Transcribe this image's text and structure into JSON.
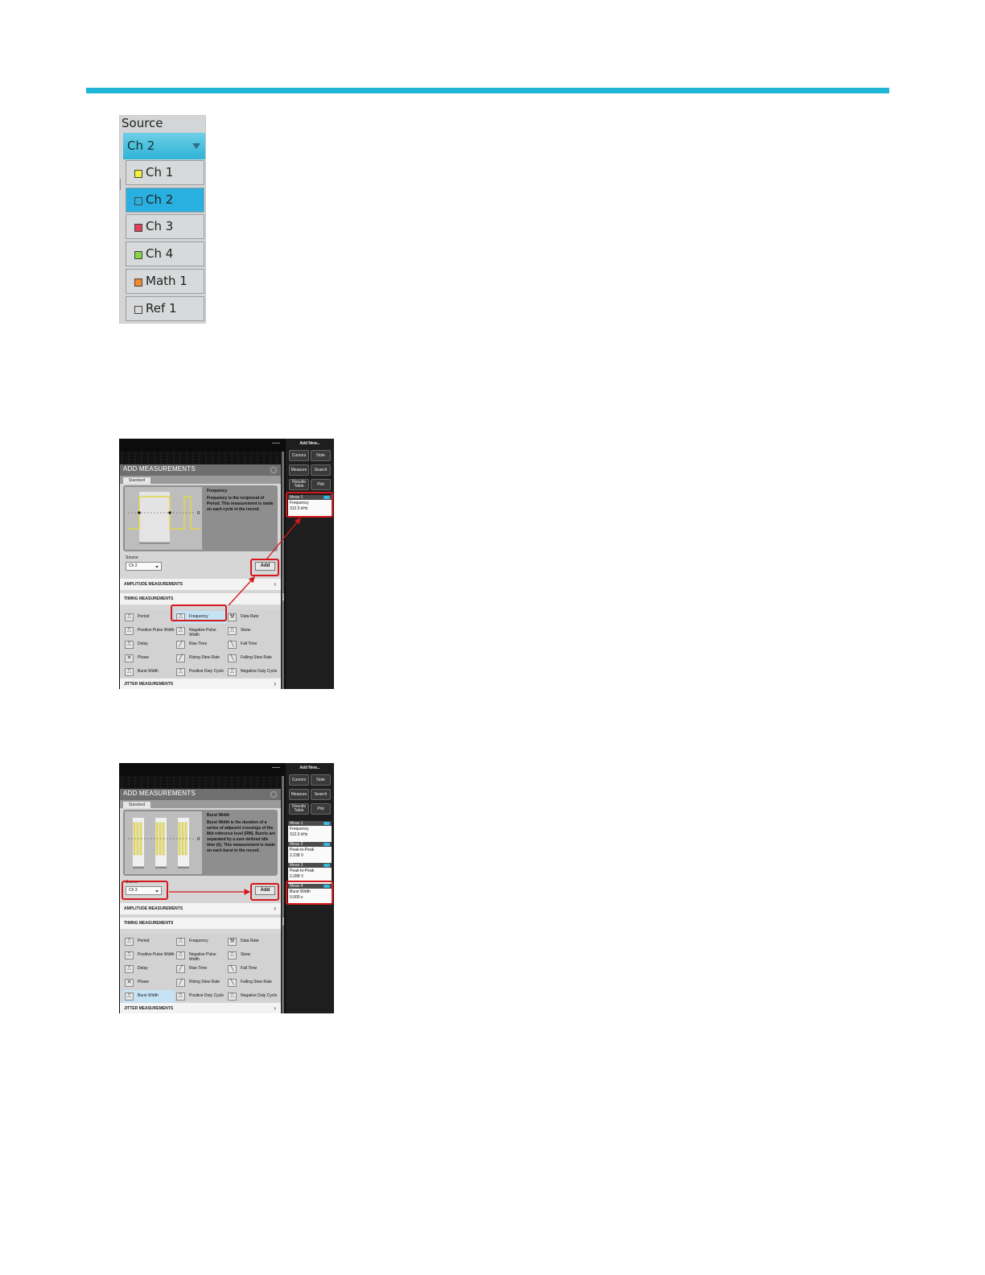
{
  "source_dropdown": {
    "title": "Source",
    "selected": "Ch 2",
    "items": [
      {
        "label": "Ch 1",
        "color": "#f1ef3a",
        "selected": false
      },
      {
        "label": "Ch 2",
        "color": "#27b0e0",
        "selected": true
      },
      {
        "label": "Ch 3",
        "color": "#e0415e",
        "selected": false
      },
      {
        "label": "Ch 4",
        "color": "#86d441",
        "selected": false
      },
      {
        "label": "Math 1",
        "color": "#f08a2c",
        "selected": false
      },
      {
        "label": "Ref 1",
        "color": "#d9d9d9",
        "selected": false
      }
    ]
  },
  "panel1": {
    "title": "ADD MEASUREMENTS",
    "tab": "Standard",
    "preview_title": "Frequency",
    "preview_desc": "Frequency is the reciprocal of Period. This measurement is made on each cycle in the record.",
    "source_label": "Source",
    "source_value": "Ch 2",
    "add_label": "Add",
    "amplitude_section": "AMPLITUDE MEASUREMENTS",
    "timing_section": "TIMING MEASUREMENTS",
    "jitter_section": "JITTER MEASUREMENTS",
    "items": [
      {
        "label": "Period",
        "icon": "period-icon"
      },
      {
        "label": "Frequency",
        "icon": "frequency-icon",
        "selected": true
      },
      {
        "label": "Data Rate",
        "icon": "data-rate-icon"
      },
      {
        "label": "Positive Pulse Width",
        "icon": "positive-pulse-width-icon"
      },
      {
        "label": "Negative Pulse Width",
        "icon": "negative-pulse-width-icon"
      },
      {
        "label": "Skew",
        "icon": "skew-icon"
      },
      {
        "label": "Delay",
        "icon": "delay-icon"
      },
      {
        "label": "Rise Time",
        "icon": "rise-time-icon"
      },
      {
        "label": "Fall Time",
        "icon": "fall-time-icon"
      },
      {
        "label": "Phase",
        "icon": "phase-icon"
      },
      {
        "label": "Rising Slew Rate",
        "icon": "rising-slew-rate-icon"
      },
      {
        "label": "Falling Slew Rate",
        "icon": "falling-slew-rate-icon"
      },
      {
        "label": "Burst Width",
        "icon": "burst-width-icon"
      },
      {
        "label": "Positive Duty Cycle",
        "icon": "positive-duty-cycle-icon"
      },
      {
        "label": "Negative Duty Cycle",
        "icon": "negative-duty-cycle-icon"
      }
    ],
    "sidebar": {
      "title": "Add New...",
      "buttons": [
        "Cursors",
        "Note",
        "Measure",
        "Search",
        "Results Table",
        "Plot"
      ],
      "badges": [
        {
          "name": "Meas 1",
          "type": "Frequency",
          "value": "312.5 kHz"
        }
      ]
    }
  },
  "panel2": {
    "title": "ADD MEASUREMENTS",
    "tab": "Standard",
    "preview_title": "Burst Width",
    "preview_desc": "Burst Width is the duration of a series of adjacent crossings of the Mid reference level (RM). Bursts are separated by a user-defined idle time (ti). This measurement is made on each burst in the record.",
    "source_label": "Source",
    "source_value": "Ch 3",
    "add_label": "Add",
    "amplitude_section": "AMPLITUDE MEASUREMENTS",
    "timing_section": "TIMING MEASUREMENTS",
    "jitter_section": "JITTER MEASUREMENTS",
    "items": [
      {
        "label": "Period",
        "icon": "period-icon"
      },
      {
        "label": "Frequency",
        "icon": "frequency-icon"
      },
      {
        "label": "Data Rate",
        "icon": "data-rate-icon"
      },
      {
        "label": "Positive Pulse Width",
        "icon": "positive-pulse-width-icon"
      },
      {
        "label": "Negative Pulse Width",
        "icon": "negative-pulse-width-icon"
      },
      {
        "label": "Skew",
        "icon": "skew-icon"
      },
      {
        "label": "Delay",
        "icon": "delay-icon"
      },
      {
        "label": "Rise Time",
        "icon": "rise-time-icon"
      },
      {
        "label": "Fall Time",
        "icon": "fall-time-icon"
      },
      {
        "label": "Phase",
        "icon": "phase-icon"
      },
      {
        "label": "Rising Slew Rate",
        "icon": "rising-slew-rate-icon"
      },
      {
        "label": "Falling Slew Rate",
        "icon": "falling-slew-rate-icon"
      },
      {
        "label": "Burst Width",
        "icon": "burst-width-icon",
        "selected": true
      },
      {
        "label": "Positive Duty Cycle",
        "icon": "positive-duty-cycle-icon"
      },
      {
        "label": "Negative Duty Cycle",
        "icon": "negative-duty-cycle-icon"
      }
    ],
    "sidebar": {
      "title": "Add New...",
      "buttons": [
        "Cursors",
        "Note",
        "Measure",
        "Search",
        "Results Table",
        "Plot"
      ],
      "badges": [
        {
          "name": "Meas 1",
          "type": "Frequency",
          "value": "312.5 kHz"
        },
        {
          "name": "Meas 2",
          "type": "Peak-to-Peak",
          "value": "2.238 V"
        },
        {
          "name": "Meas 3",
          "type": "Peak-to-Peak",
          "value": "2.288 V"
        },
        {
          "name": "Meas 4",
          "type": "Burst Width",
          "value": "0.000 s"
        }
      ]
    }
  },
  "colors": {
    "accent_bar": "#1fb5d7",
    "highlight": "#d3191d",
    "selected_blue": "#27b0e0"
  }
}
